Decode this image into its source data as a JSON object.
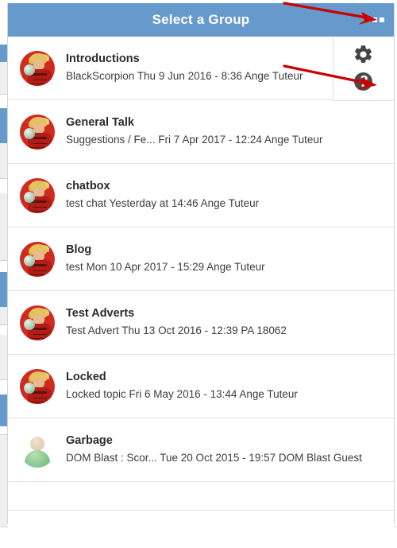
{
  "panel": {
    "title": "Select a Group",
    "header_color": "#6699cc",
    "overflow_menu_label": "•••",
    "overflow_menu_name": "more-options"
  },
  "tools": {
    "settings_label": "Settings",
    "help_label": "Help",
    "icon_color": "#444444"
  },
  "groups": [
    {
      "title": "Introductions",
      "subtitle": "BlackScorpion Thu 9 Jun 2016 - 8:36 Ange Tuteur",
      "avatar": "character-avatar"
    },
    {
      "title": "General Talk",
      "subtitle": "Suggestions / Fe... Fri 7 Apr 2017 - 12:24 Ange Tuteur",
      "avatar": "character-avatar"
    },
    {
      "title": "chatbox",
      "subtitle": "test chat Yesterday at 14:46 Ange Tuteur",
      "avatar": "character-avatar"
    },
    {
      "title": "Blog",
      "subtitle": "test Mon 10 Apr 2017 - 15:29 Ange Tuteur",
      "avatar": "character-avatar"
    },
    {
      "title": "Test Adverts",
      "subtitle": "Test Advert Thu 13 Oct 2016 - 12:39 PA 18062",
      "avatar": "character-avatar"
    },
    {
      "title": "Locked",
      "subtitle": "Locked topic Fri 6 May 2016 - 13:44 Ange Tuteur",
      "avatar": "character-avatar"
    },
    {
      "title": "Garbage",
      "subtitle": "DOM Blast : Scor... Tue 20 Oct 2015 - 19:57 DOM Blast Guest",
      "avatar": "guest-avatar"
    }
  ],
  "annotations": {
    "arrow_color": "#cc0000",
    "arrow_overflow_target": "more-options-button",
    "arrow_help_target": "help-button"
  },
  "backdrop": {
    "accent_color": "#6699cc",
    "panel_bg": "#eeeeee"
  }
}
